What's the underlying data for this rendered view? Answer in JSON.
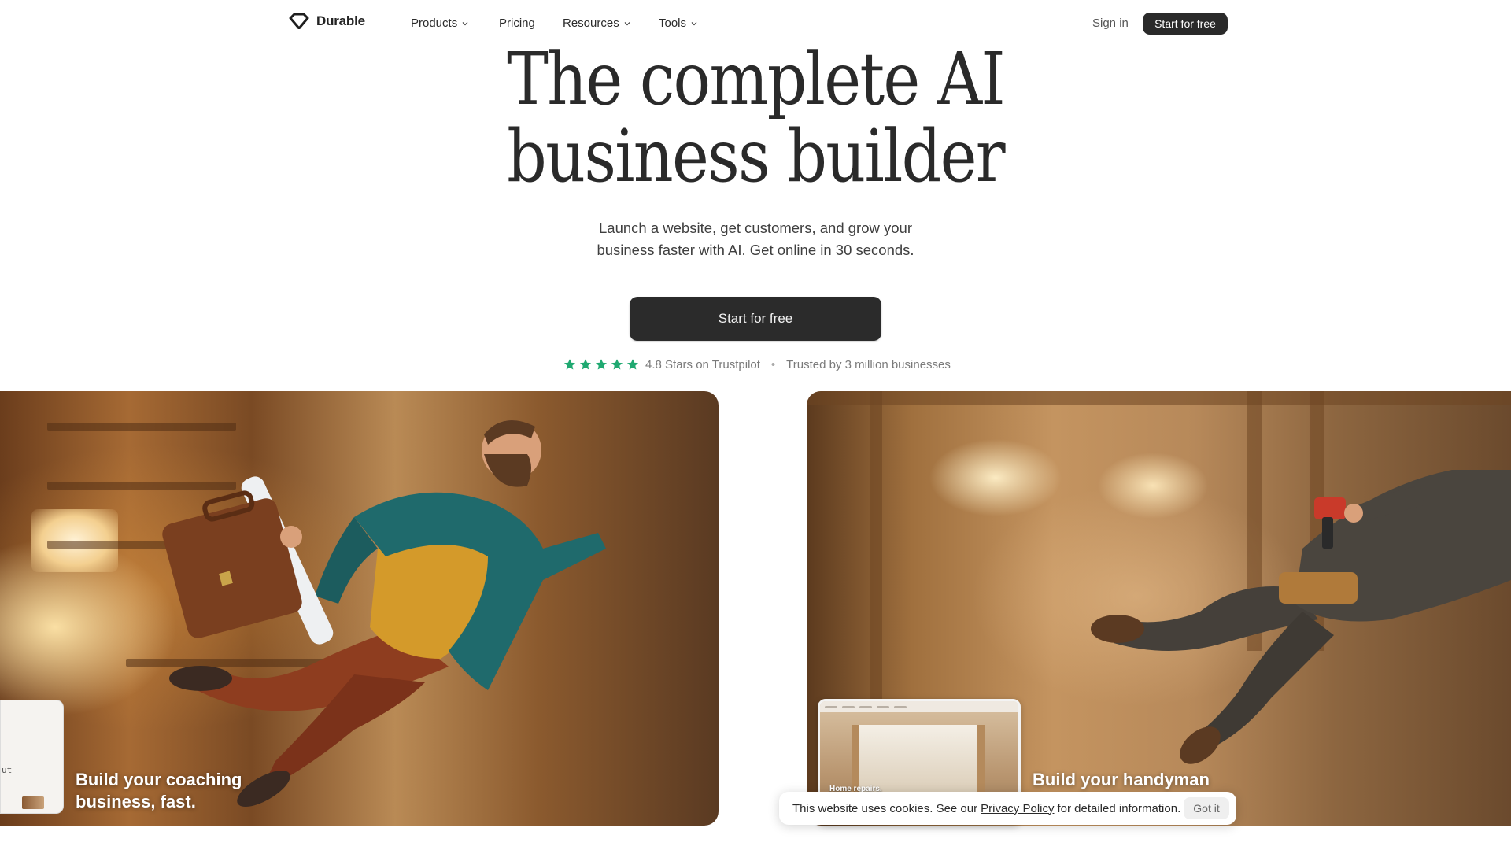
{
  "nav": {
    "brand": "Durable",
    "items": [
      {
        "label": "Products",
        "has_dropdown": true
      },
      {
        "label": "Pricing",
        "has_dropdown": false
      },
      {
        "label": "Resources",
        "has_dropdown": true
      },
      {
        "label": "Tools",
        "has_dropdown": true
      }
    ],
    "sign_in": "Sign in",
    "cta": "Start for free"
  },
  "hero": {
    "headline_line1": "The complete AI",
    "headline_line2": "business builder",
    "sub_line1": "Launch a website, get customers, and grow your",
    "sub_line2": "business faster with AI. Get online in 30 seconds.",
    "cta": "Start for free",
    "rating_text": "4.8 Stars on Trustpilot",
    "trusted_text": "Trusted by 3 million businesses",
    "star_count": 5,
    "star_color": "#1fa971"
  },
  "cards": {
    "left": {
      "caption_line1": "Build your coaching",
      "caption_line2": "business, fast.",
      "mini_text": "ut"
    },
    "right": {
      "caption_line1": "Build your handyman",
      "preview_label": "Home repairs,"
    }
  },
  "cookie": {
    "text_before": "This website uses cookies. See our",
    "link": "Privacy Policy",
    "text_after": "for detailed information.",
    "button": "Got it"
  },
  "colors": {
    "dark": "#2a2a2a",
    "accent_star": "#1fa971"
  }
}
